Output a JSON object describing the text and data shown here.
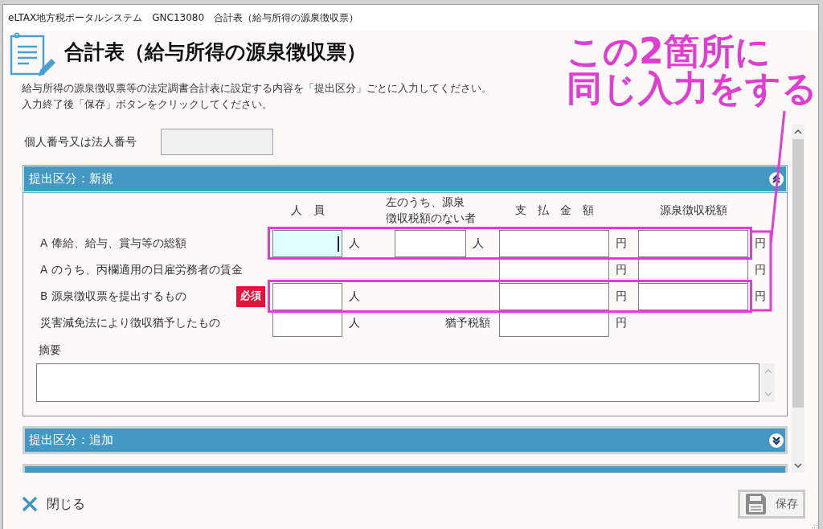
{
  "window": {
    "title": "eLTAX地方税ポータルシステム　GNC13080　合計表（給与所得の源泉徴収票）"
  },
  "header": {
    "title": "合計表（給与所得の源泉徴収票）",
    "instructions": [
      "給与所得の源泉徴収票等の法定調書合計表に設定する内容を「提出区分」ごとに入力してください。",
      "入力終了後「保存」ボタンをクリックしてください。"
    ]
  },
  "annotation": {
    "lines": [
      "この2箇所に",
      "同じ入力をする"
    ]
  },
  "number_field": {
    "label": "個人番号又は法人番号",
    "disabled": true
  },
  "sections": [
    {
      "title": "提出区分：新規",
      "expanded": true,
      "columns": [
        {
          "lines": [
            "人　員"
          ]
        },
        {
          "lines": [
            "左のうち、源泉",
            "徴収税額のない者"
          ]
        },
        {
          "lines": [
            "支　払　金　額"
          ]
        },
        {
          "lines": [
            "源泉徴収税額"
          ]
        }
      ],
      "rows": [
        {
          "label": "A 俸給、給与、賞与等の総額",
          "highlighted": true,
          "cells": [
            {
              "kind": "field",
              "unit": "人",
              "focused": true
            },
            {
              "kind": "field",
              "unit": "人",
              "focused": false
            },
            {
              "kind": "field",
              "unit": "円",
              "focused": false
            },
            {
              "kind": "field",
              "unit": "円",
              "focused": false
            }
          ]
        },
        {
          "label": "A のうち、丙欄適用の日雇労務者の賃金",
          "highlighted": false,
          "cells": [
            {
              "kind": "blank"
            },
            {
              "kind": "blank"
            },
            {
              "kind": "field",
              "unit": "円",
              "focused": false
            },
            {
              "kind": "field",
              "unit": "円",
              "focused": false
            }
          ]
        },
        {
          "label": "B 源泉徴収票を提出するもの",
          "required_badge": "必須",
          "highlighted": true,
          "cells": [
            {
              "kind": "field",
              "unit": "人",
              "focused": false
            },
            {
              "kind": "blank"
            },
            {
              "kind": "field",
              "unit": "円",
              "focused": false
            },
            {
              "kind": "field",
              "unit": "円",
              "focused": false
            }
          ]
        },
        {
          "label": "災害減免法により徴収猶予したもの",
          "highlighted": false,
          "cells": [
            {
              "kind": "field",
              "unit": "人",
              "focused": false
            },
            {
              "kind": "text",
              "text": "猶予税額"
            },
            {
              "kind": "field",
              "unit": "円",
              "focused": false
            },
            {
              "kind": "blank"
            }
          ]
        }
      ],
      "memo": {
        "label": "摘要"
      }
    },
    {
      "title": "提出区分：追加",
      "expanded": false
    },
    {
      "expanded": false
    }
  ],
  "buttons": [
    {
      "kind": "close",
      "label": "閉じる",
      "disabled": false
    },
    {
      "kind": "save",
      "label": "保存",
      "disabled": true
    }
  ]
}
